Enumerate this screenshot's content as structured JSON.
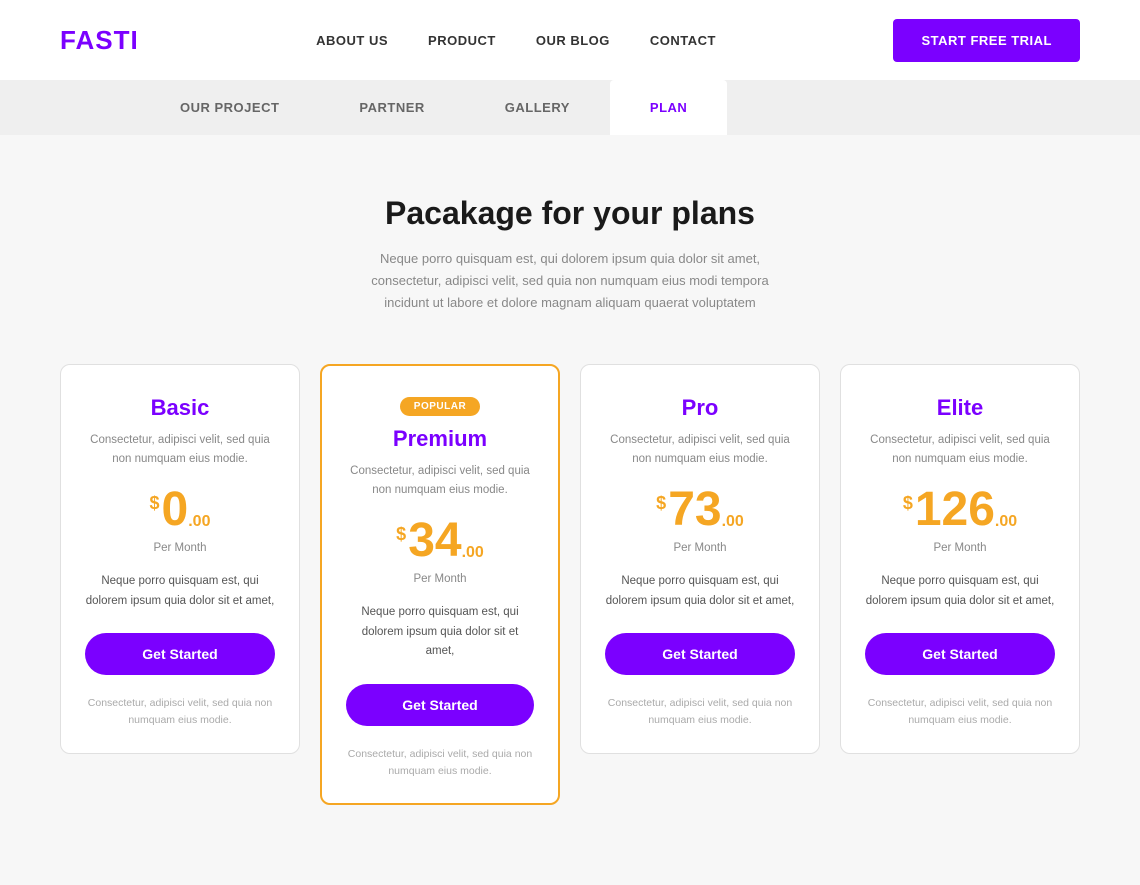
{
  "header": {
    "logo": "FASTI",
    "nav": [
      {
        "label": "ABOUT US",
        "id": "about-us"
      },
      {
        "label": "PRODUCT",
        "id": "product"
      },
      {
        "label": "OUR BLOG",
        "id": "our-blog"
      },
      {
        "label": "CONTACT",
        "id": "contact"
      }
    ],
    "cta": "START FREE TRIAL"
  },
  "tabs": [
    {
      "label": "OUR PROJECT",
      "active": false
    },
    {
      "label": "PARTNER",
      "active": false
    },
    {
      "label": "GALLERY",
      "active": false
    },
    {
      "label": "PLAN",
      "active": true
    }
  ],
  "section": {
    "title": "Pacakage for your plans",
    "subtitle": "Neque porro quisquam est, qui dolorem ipsum quia dolor sit amet, consectetur, adipisci velit, sed quia non numquam eius modi tempora incidunt ut labore et dolore magnam aliquam quaerat voluptatem"
  },
  "plans": [
    {
      "id": "basic",
      "title": "Basic",
      "desc": "Consectetur, adipisci velit, sed quia non numquam eius modie.",
      "price_symbol": "$",
      "price_integer": "0",
      "price_decimal": ".00",
      "per_month": "Per Month",
      "feature": "Neque porro quisquam est, qui dolorem ipsum quia dolor sit et amet,",
      "btn": "Get Started",
      "footer": "Consectetur, adipisci velit, sed quia non numquam eius modie.",
      "featured": false,
      "popular_badge": ""
    },
    {
      "id": "premium",
      "title": "Premium",
      "desc": "Consectetur, adipisci velit, sed quia non numquam eius modie.",
      "price_symbol": "$",
      "price_integer": "34",
      "price_decimal": ".00",
      "per_month": "Per Month",
      "feature": "Neque porro quisquam est, qui dolorem ipsum quia dolor sit et amet,",
      "btn": "Get Started",
      "footer": "Consectetur, adipisci velit, sed quia non numquam eius modie.",
      "featured": true,
      "popular_badge": "POPULAR"
    },
    {
      "id": "pro",
      "title": "Pro",
      "desc": "Consectetur, adipisci velit, sed quia non numquam eius modie.",
      "price_symbol": "$",
      "price_integer": "73",
      "price_decimal": ".00",
      "per_month": "Per Month",
      "feature": "Neque porro quisquam est, qui dolorem ipsum quia dolor sit et amet,",
      "btn": "Get Started",
      "footer": "Consectetur, adipisci velit, sed quia non numquam eius modie.",
      "featured": false,
      "popular_badge": ""
    },
    {
      "id": "elite",
      "title": "Elite",
      "desc": "Consectetur, adipisci velit, sed quia non numquam eius modie.",
      "price_symbol": "$",
      "price_integer": "126",
      "price_decimal": ".00",
      "per_month": "Per Month",
      "feature": "Neque porro quisquam est, qui dolorem ipsum quia dolor sit et amet,",
      "btn": "Get Started",
      "footer": "Consectetur, adipisci velit, sed quia non numquam eius modie.",
      "featured": false,
      "popular_badge": ""
    }
  ]
}
